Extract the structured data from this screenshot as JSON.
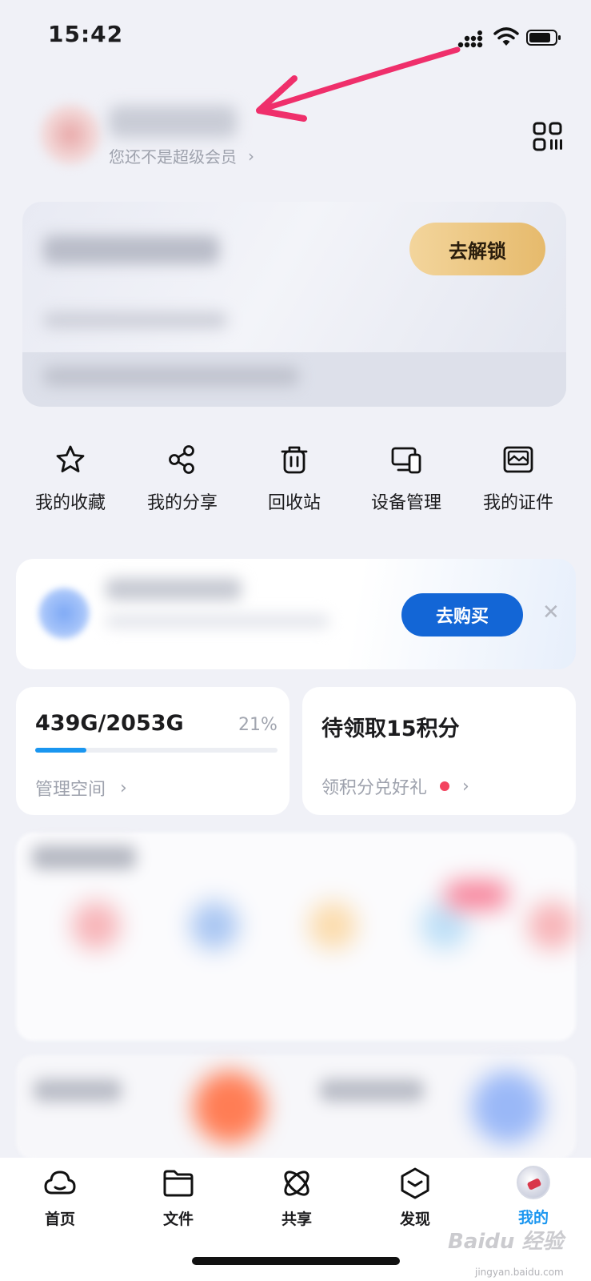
{
  "status_bar": {
    "time": "15:42"
  },
  "profile": {
    "vip_status": "您还不是超级会员",
    "chevron": "›",
    "qr_icon": "scan-qr-icon"
  },
  "vip_card": {
    "unlock_label": "去解锁"
  },
  "quick_actions": [
    {
      "label": "我的收藏",
      "icon": "star-icon"
    },
    {
      "label": "我的分享",
      "icon": "share-icon"
    },
    {
      "label": "回收站",
      "icon": "trash-icon"
    },
    {
      "label": "设备管理",
      "icon": "devices-icon"
    },
    {
      "label": "我的证件",
      "icon": "id-card-icon"
    }
  ],
  "promo": {
    "buy_label": "去购买",
    "close_glyph": "✕"
  },
  "storage": {
    "used_total": "439G/2053G",
    "percent_label": "21%",
    "percent_value": 0.21,
    "manage_label": "管理空间",
    "chevron": "›"
  },
  "points": {
    "title": "待领取15积分",
    "link_label": "领积分兑好礼",
    "chevron": "›"
  },
  "tabbar": {
    "tabs": [
      {
        "label": "首页",
        "icon": "cloud-icon"
      },
      {
        "label": "文件",
        "icon": "folder-icon"
      },
      {
        "label": "共享",
        "icon": "share-orbit-icon"
      },
      {
        "label": "发现",
        "icon": "discover-box-icon"
      },
      {
        "label": "我的",
        "icon": "avatar-icon",
        "active": true
      }
    ]
  },
  "watermark": {
    "brand": "Baidu 经验",
    "url": "jingyan.baidu.com"
  },
  "colors": {
    "accent": "#1a96f0",
    "buy_button": "#1366d6",
    "unlock_gold": "#e6ba6c",
    "arrow": "#ef2f6b",
    "red_dot": "#f3435f"
  }
}
